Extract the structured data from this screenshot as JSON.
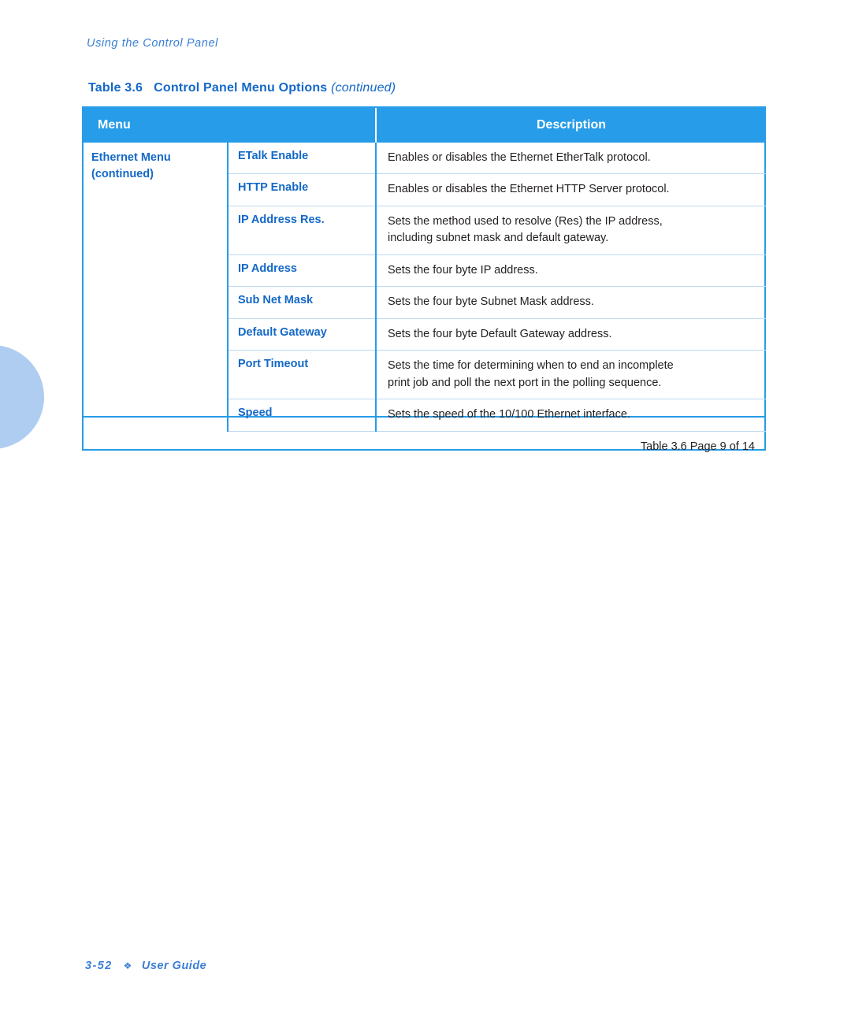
{
  "running_header": "Using the Control Panel",
  "caption": {
    "table_number": "Table 3.6",
    "title": "Control Panel Menu Options",
    "continued": "(continued)"
  },
  "table": {
    "headers": {
      "menu": "Menu",
      "description": "Description"
    },
    "menu_group": {
      "name": "Ethernet Menu",
      "continued": "(continued)"
    },
    "rows": [
      {
        "option": "ETalk Enable",
        "desc_line1": "Enables or disables the Ethernet EtherTalk protocol.",
        "desc_line2": ""
      },
      {
        "option": "HTTP Enable",
        "desc_line1": "Enables or disables the Ethernet HTTP Server protocol.",
        "desc_line2": ""
      },
      {
        "option": "IP Address Res.",
        "desc_line1": "Sets the method used to resolve (Res) the IP address,",
        "desc_line2": "including subnet mask and default gateway."
      },
      {
        "option": "IP Address",
        "desc_line1": "Sets the four byte IP address.",
        "desc_line2": ""
      },
      {
        "option": "Sub Net Mask",
        "desc_line1": "Sets the four byte Subnet Mask address.",
        "desc_line2": ""
      },
      {
        "option": "Default Gateway",
        "desc_line1": "Sets the four byte Default Gateway address.",
        "desc_line2": ""
      },
      {
        "option": "Port Timeout",
        "desc_line1": "Sets the time for determining when to end an incomplete",
        "desc_line2": "print job and poll the next port in the polling sequence."
      },
      {
        "option": "Speed",
        "desc_line1": "Sets the speed of the 10/100 Ethernet interface.",
        "desc_line2": ""
      }
    ],
    "footer": "Table 3.6  Page 9 of 14"
  },
  "page_footer": {
    "page_number": "3-52",
    "diamond": "❖",
    "label": "User Guide"
  },
  "colors": {
    "header_blue": "#279ce8",
    "text_blue": "#1368c8",
    "accent_italic_blue": "#3a7fd5",
    "rule_light": "#bcd9f2",
    "blob": "#aecdf0",
    "body_text": "#231f20"
  }
}
